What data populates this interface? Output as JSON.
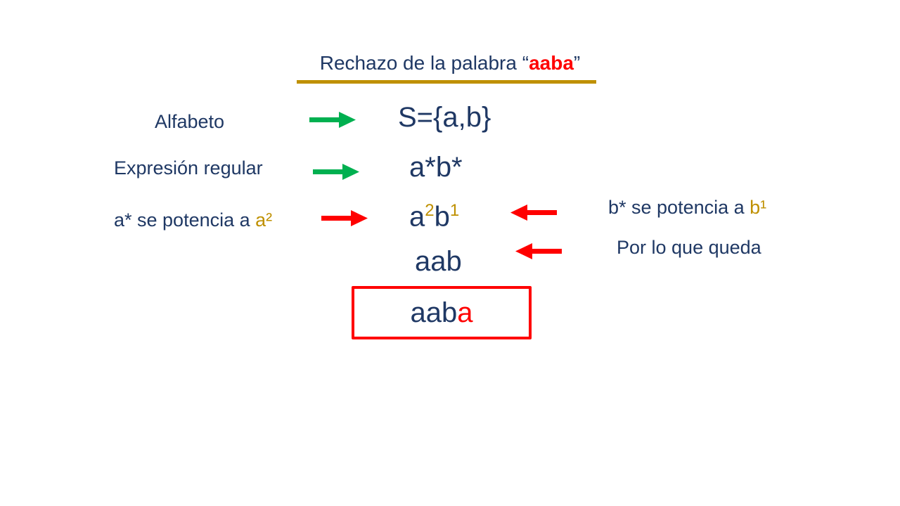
{
  "title": {
    "prefix": "Rechazo de la palabra",
    "open_quote": "“",
    "word": "aaba",
    "close_quote": "”"
  },
  "rows": {
    "alphabet": {
      "label": "Alfabeto",
      "value": "S={a,b}"
    },
    "regex": {
      "label": "Expresión regular",
      "value": "a*b*"
    },
    "power": {
      "left_label_prefix": "a* se potencia a",
      "left_label_highlight": "a²",
      "base_a": "a",
      "exp_a": "2",
      "base_b": "b",
      "exp_b": "1",
      "right_label_prefix": "b* se potencia a",
      "right_label_highlight": "b¹"
    },
    "result": {
      "value": "aab",
      "note": "Por lo que queda"
    },
    "rejected": {
      "accepted_part": "aab",
      "extra_part": "a"
    }
  },
  "colors": {
    "text": "#1f3864",
    "accent_gold": "#bf9000",
    "reject_red": "#ff0000",
    "arrow_green": "#00b050"
  }
}
